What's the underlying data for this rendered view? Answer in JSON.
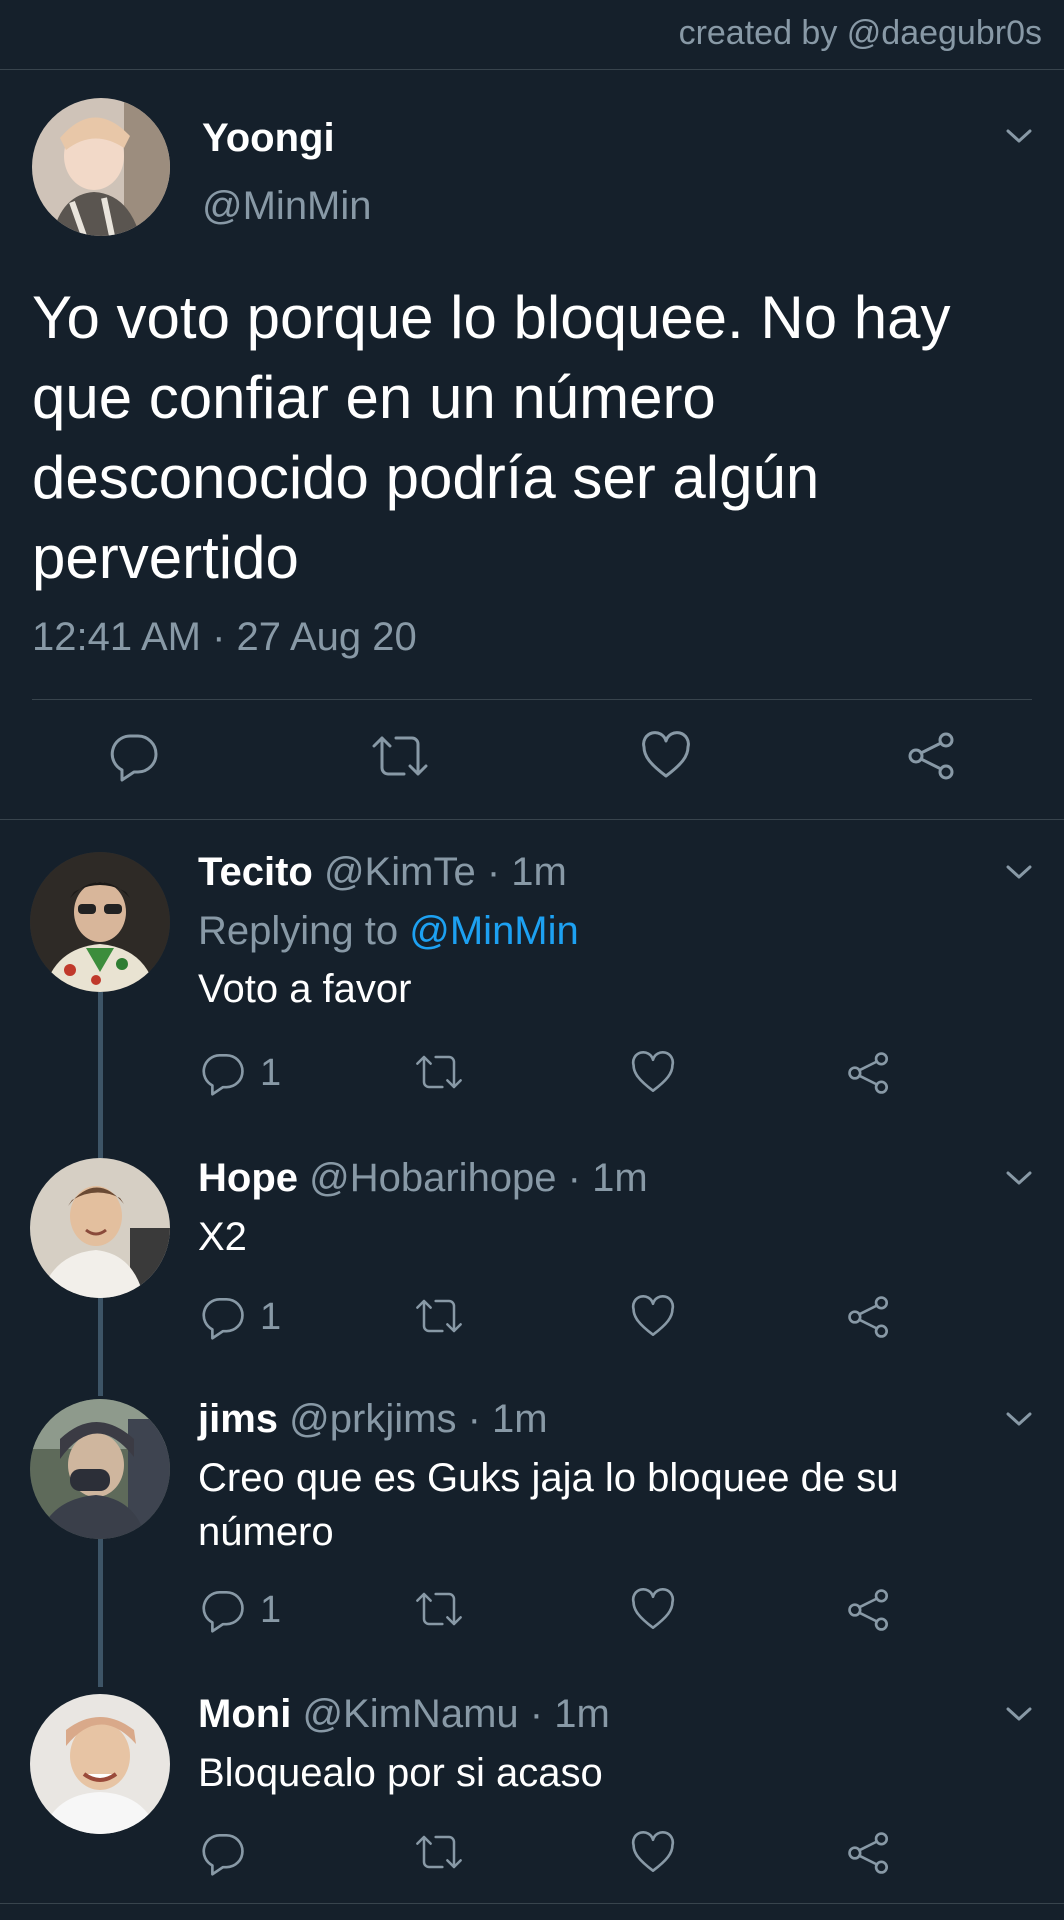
{
  "credit": "created by @daegubr0s",
  "main_tweet": {
    "name": "Yoongi",
    "handle": "@MinMin",
    "text": "Yo voto porque lo bloquee. No hay que confiar en un número desconocido podría ser algún pervertido",
    "timestamp": "12:41 AM · 27 Aug 20",
    "actions": [
      "reply-icon",
      "retweet-icon",
      "like-icon",
      "share-icon"
    ]
  },
  "replies": [
    {
      "name": "Tecito",
      "handle": "@KimTe",
      "time": "· 1m",
      "replying_prefix": "Replying to",
      "replying_to": "@MinMin",
      "text_lines": [
        "Voto a favor"
      ],
      "reply_count": "1"
    },
    {
      "name": "Hope",
      "handle": "@Hobarihope",
      "time": "· 1m",
      "text_lines": [
        "X2"
      ],
      "reply_count": "1"
    },
    {
      "name": "jims",
      "handle": "@prkjims",
      "time": "· 1m",
      "text_lines": [
        "Creo que es Guks jaja lo bloquee de su",
        "número"
      ],
      "reply_count": "1"
    },
    {
      "name": "Moni",
      "handle": "@KimNamu",
      "time": "· 1m",
      "text_lines": [
        "Bloquealo por si acaso"
      ],
      "reply_count": ""
    }
  ],
  "colors": {
    "background": "#15202b",
    "muted": "#8899a6",
    "link": "#1da1f2",
    "divider": "#38444d",
    "thread_line": "#3d5466"
  }
}
